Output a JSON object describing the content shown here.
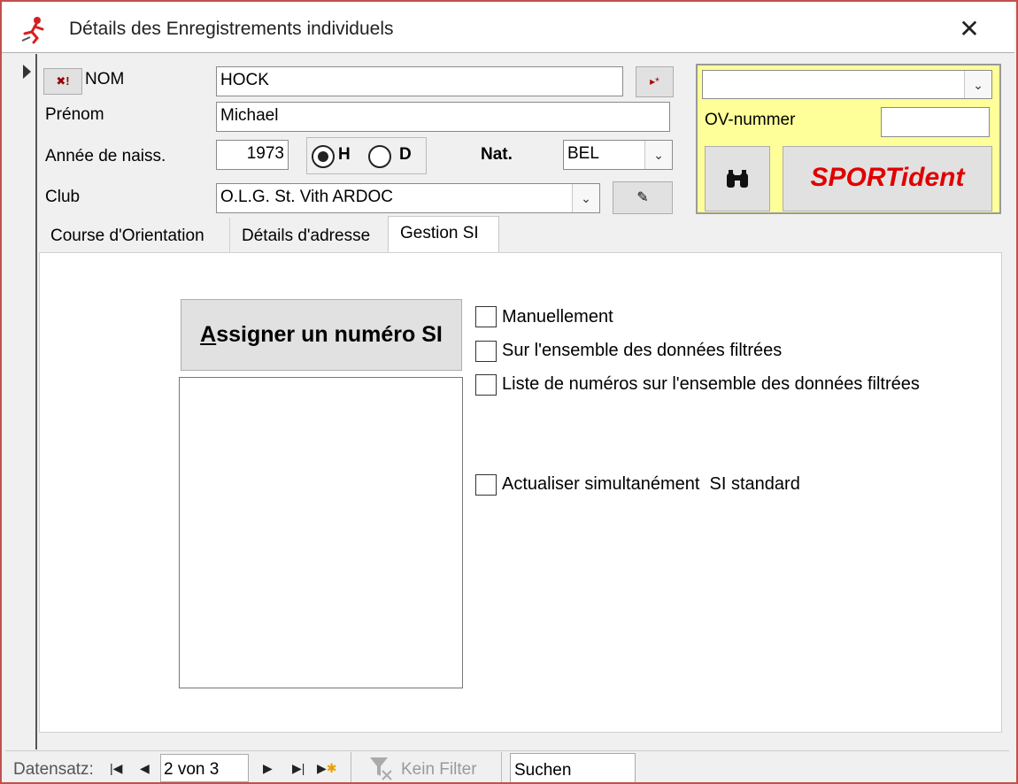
{
  "window": {
    "title": "Détails des Enregistrements individuels",
    "close_glyph": "✕",
    "app_icon": "sportident-runner-icon"
  },
  "form": {
    "nom_label": "NOM",
    "nom_value": "HOCK",
    "prenom_label": "Prénom",
    "prenom_value": "Michael",
    "annee_label": "Année de naiss.",
    "annee_value": "1973",
    "gender_h": "H",
    "gender_d": "D",
    "gender_selected": "H",
    "nat_label": "Nat.",
    "nat_value": "BEL",
    "club_label": "Club",
    "club_value": "O.L.G. St. Vith ARDOC",
    "clear_btn_glyph": "✖!",
    "nav_btn_glyph": "▸*",
    "club_edit_glyph": "✎"
  },
  "si_box": {
    "combo_value": "",
    "ov_label": "OV-nummer",
    "ov_value": "",
    "binoculars_glyph": "👓",
    "sportident_label": "SPORTident",
    "sportident_color": "#e00000",
    "bg_color": "#ffff99"
  },
  "tabs": [
    {
      "label": "Course d'Orientation",
      "active": false
    },
    {
      "label": "Détails d'adresse",
      "active": false
    },
    {
      "label": "Gestion SI",
      "active": true
    }
  ],
  "gestion": {
    "assign_label_mnemonic": "A",
    "assign_label_rest": "ssigner un numéro SI",
    "checks": [
      {
        "label": "Manuellement",
        "checked": false
      },
      {
        "label": "Sur l'ensemble des données filtrées",
        "checked": false
      },
      {
        "label": "Liste de numéros sur l'ensemble des données filtrées",
        "checked": false
      },
      {
        "label": "Actualiser simultanément  SI standard",
        "checked": false
      }
    ]
  },
  "statusbar": {
    "record_label": "Datensatz:",
    "record_value": "2 von 3",
    "filter_label": "Kein Filter",
    "search_value": "Suchen"
  }
}
